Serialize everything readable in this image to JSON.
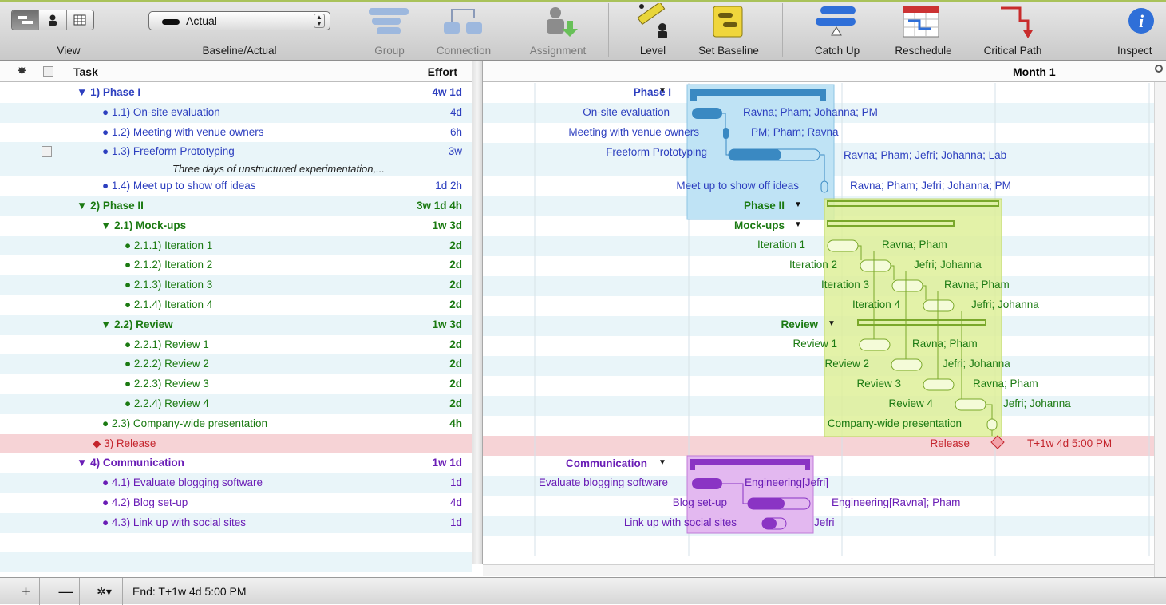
{
  "toolbar": {
    "view_label": "View",
    "baseline_label": "Baseline/Actual",
    "baseline_value": "Actual",
    "group_label": "Group",
    "connection_label": "Connection",
    "assignment_label": "Assignment",
    "level_label": "Level",
    "set_baseline_label": "Set Baseline",
    "catch_up_label": "Catch Up",
    "reschedule_label": "Reschedule",
    "critical_path_label": "Critical Path",
    "inspect_label": "Inspect"
  },
  "outline": {
    "task_header": "Task",
    "effort_header": "Effort",
    "rows": [
      {
        "name": "▼ 1)  Phase I",
        "effort": "4w 1d"
      },
      {
        "name": "●  1.1)  On-site evaluation",
        "effort": "4d"
      },
      {
        "name": "●  1.2)  Meeting with venue owners",
        "effort": "6h"
      },
      {
        "name": "●  1.3)  Freeform Prototyping",
        "effort": "3w"
      },
      {
        "note": "Three days of unstructured experimentation,..."
      },
      {
        "name": "●  1.4)  Meet up to show off ideas",
        "effort": "1d 2h"
      },
      {
        "name": "▼ 2)  Phase II",
        "effort": "3w 1d 4h"
      },
      {
        "name": "▼ 2.1)  Mock-ups",
        "effort": "1w 3d"
      },
      {
        "name": "●  2.1.1)  Iteration 1",
        "effort": "2d"
      },
      {
        "name": "●  2.1.2)  Iteration 2",
        "effort": "2d"
      },
      {
        "name": "●  2.1.3)  Iteration 3",
        "effort": "2d"
      },
      {
        "name": "●  2.1.4)  Iteration 4",
        "effort": "2d"
      },
      {
        "name": "▼ 2.2)  Review",
        "effort": "1w 3d"
      },
      {
        "name": "●  2.2.1)  Review 1",
        "effort": "2d"
      },
      {
        "name": "●  2.2.2)  Review 2",
        "effort": "2d"
      },
      {
        "name": "●  2.2.3)  Review 3",
        "effort": "2d"
      },
      {
        "name": "●  2.2.4)  Review 4",
        "effort": "2d"
      },
      {
        "name": "●  2.3)  Company-wide presentation",
        "effort": "4h"
      },
      {
        "name": "◆  3)  Release",
        "effort": ""
      },
      {
        "name": "▼ 4)  Communication",
        "effort": "1w 1d"
      },
      {
        "name": "●  4.1)  Evaluate blogging software",
        "effort": "1d"
      },
      {
        "name": "●  4.2)  Blog set-up",
        "effort": "4d"
      },
      {
        "name": "●  4.3)  Link up with social sites",
        "effort": "1d"
      }
    ]
  },
  "gantt": {
    "month_label": "Month 1",
    "labels": {
      "phase1": "Phase I",
      "onsite": "On-site evaluation",
      "meeting": "Meeting with venue owners",
      "freeform": "Freeform Prototyping",
      "meetup": "Meet up to show off ideas",
      "phase2": "Phase II",
      "mockups": "Mock-ups",
      "it1": "Iteration 1",
      "it2": "Iteration 2",
      "it3": "Iteration 3",
      "it4": "Iteration 4",
      "review": "Review",
      "rv1": "Review 1",
      "rv2": "Review 2",
      "rv3": "Review 3",
      "rv4": "Review 4",
      "company": "Company-wide presentation",
      "release": "Release",
      "release_date": "T+1w 4d 5:00 PM",
      "communication": "Communication",
      "evaluate": "Evaluate blogging software",
      "blogsetup": "Blog set-up",
      "linkup": "Link up with social sites"
    },
    "resources": {
      "onsite": "Ravna; Pham; Johanna; PM",
      "meeting": "PM; Pham; Ravna",
      "freeform": "Ravna; Pham; Jefri; Johanna; Lab",
      "meetup": "Ravna; Pham; Jefri; Johanna; PM",
      "it1": "Ravna; Pham",
      "it2": "Jefri; Johanna",
      "it3": "Ravna; Pham",
      "it4": "Jefri; Johanna",
      "rv1": "Ravna; Pham",
      "rv2": "Jefri; Johanna",
      "rv3": "Ravna; Pham",
      "rv4": "Jefri; Johanna",
      "evaluate": "Engineering[Jefri]",
      "blogsetup": "Engineering[Ravna]; Pham",
      "linkup": "Jefri"
    }
  },
  "statusbar": {
    "add_label": "+",
    "remove_label": "—",
    "gear_label": "✲▾",
    "end_text": "End: T+1w 4d 5:00 PM"
  },
  "colors": {
    "blue_text": "#2d3fbf",
    "green_text": "#1b7a12",
    "purple_text": "#6a1db6",
    "release_red": "#c4242c",
    "phase1_box": "#bfe3f5",
    "phase2_box": "#dff09a",
    "communication_box": "#e3b8f0"
  }
}
